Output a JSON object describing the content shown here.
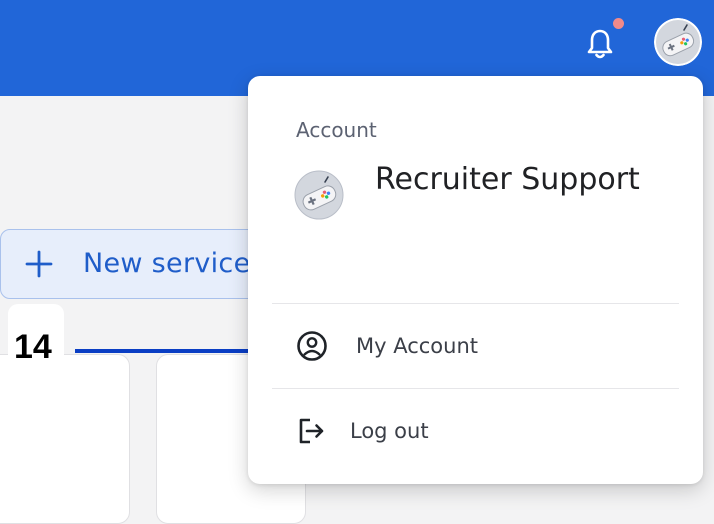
{
  "header": {
    "notifications_icon": "bell-icon",
    "notification_dot_color": "#f08a8a",
    "avatar_icon": "gamepad-avatar-icon",
    "brand_color": "#2166d8"
  },
  "main": {
    "new_service_label": "New service",
    "new_service_icon": "plus-icon",
    "annotation_number": "14"
  },
  "account_menu": {
    "heading": "Account",
    "user_name": "Recruiter Support",
    "avatar_icon": "gamepad-avatar-icon",
    "items": [
      {
        "label": "My Account",
        "icon": "user-circle-icon"
      },
      {
        "label": "Log out",
        "icon": "logout-icon"
      }
    ]
  }
}
